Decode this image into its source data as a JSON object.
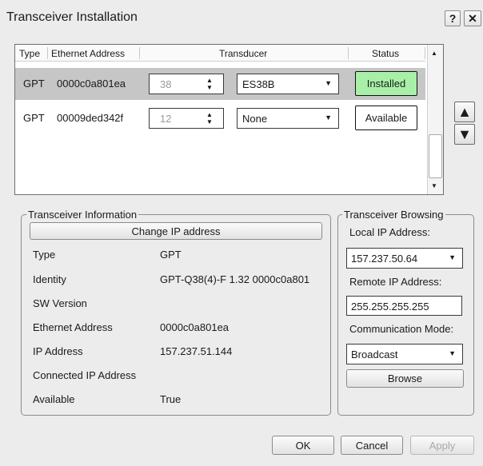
{
  "window": {
    "title": "Transceiver Installation",
    "help_label": "?",
    "close_label": "✕"
  },
  "table": {
    "headers": {
      "type": "Type",
      "ethernet": "Ethernet Address",
      "transducer": "Transducer",
      "status": "Status"
    },
    "rows": [
      {
        "type": "GPT",
        "ethernet": "0000c0a801ea",
        "channel": "38",
        "transducer": "ES38B",
        "status": "Installed"
      },
      {
        "type": "GPT",
        "ethernet": "00009ded342f",
        "channel": "12",
        "transducer": "None",
        "status": "Available"
      }
    ]
  },
  "info": {
    "group_label": "Transceiver Information",
    "change_ip_button": "Change IP address",
    "rows": [
      {
        "label": "Type",
        "value": "GPT"
      },
      {
        "label": "Identity",
        "value": "GPT-Q38(4)-F 1.32 0000c0a801"
      },
      {
        "label": "SW Version",
        "value": ""
      },
      {
        "label": "Ethernet Address",
        "value": "0000c0a801ea"
      },
      {
        "label": "IP Address",
        "value": "157.237.51.144"
      },
      {
        "label": "Connected IP Address",
        "value": ""
      },
      {
        "label": "Available",
        "value": "True"
      }
    ]
  },
  "browsing": {
    "group_label": "Transceiver Browsing",
    "local_ip_label": "Local IP Address:",
    "local_ip_value": "157.237.50.64",
    "remote_ip_label": "Remote IP Address:",
    "remote_ip_value": "255.255.255.255",
    "comm_mode_label": "Communication Mode:",
    "comm_mode_value": "Broadcast",
    "browse_button": "Browse"
  },
  "footer": {
    "ok": "OK",
    "cancel": "Cancel",
    "apply": "Apply"
  },
  "colors": {
    "installed_bg": "#a8f0a8",
    "selected_row": "#c6c6c6",
    "disabled_text": "#9a9a9a"
  }
}
